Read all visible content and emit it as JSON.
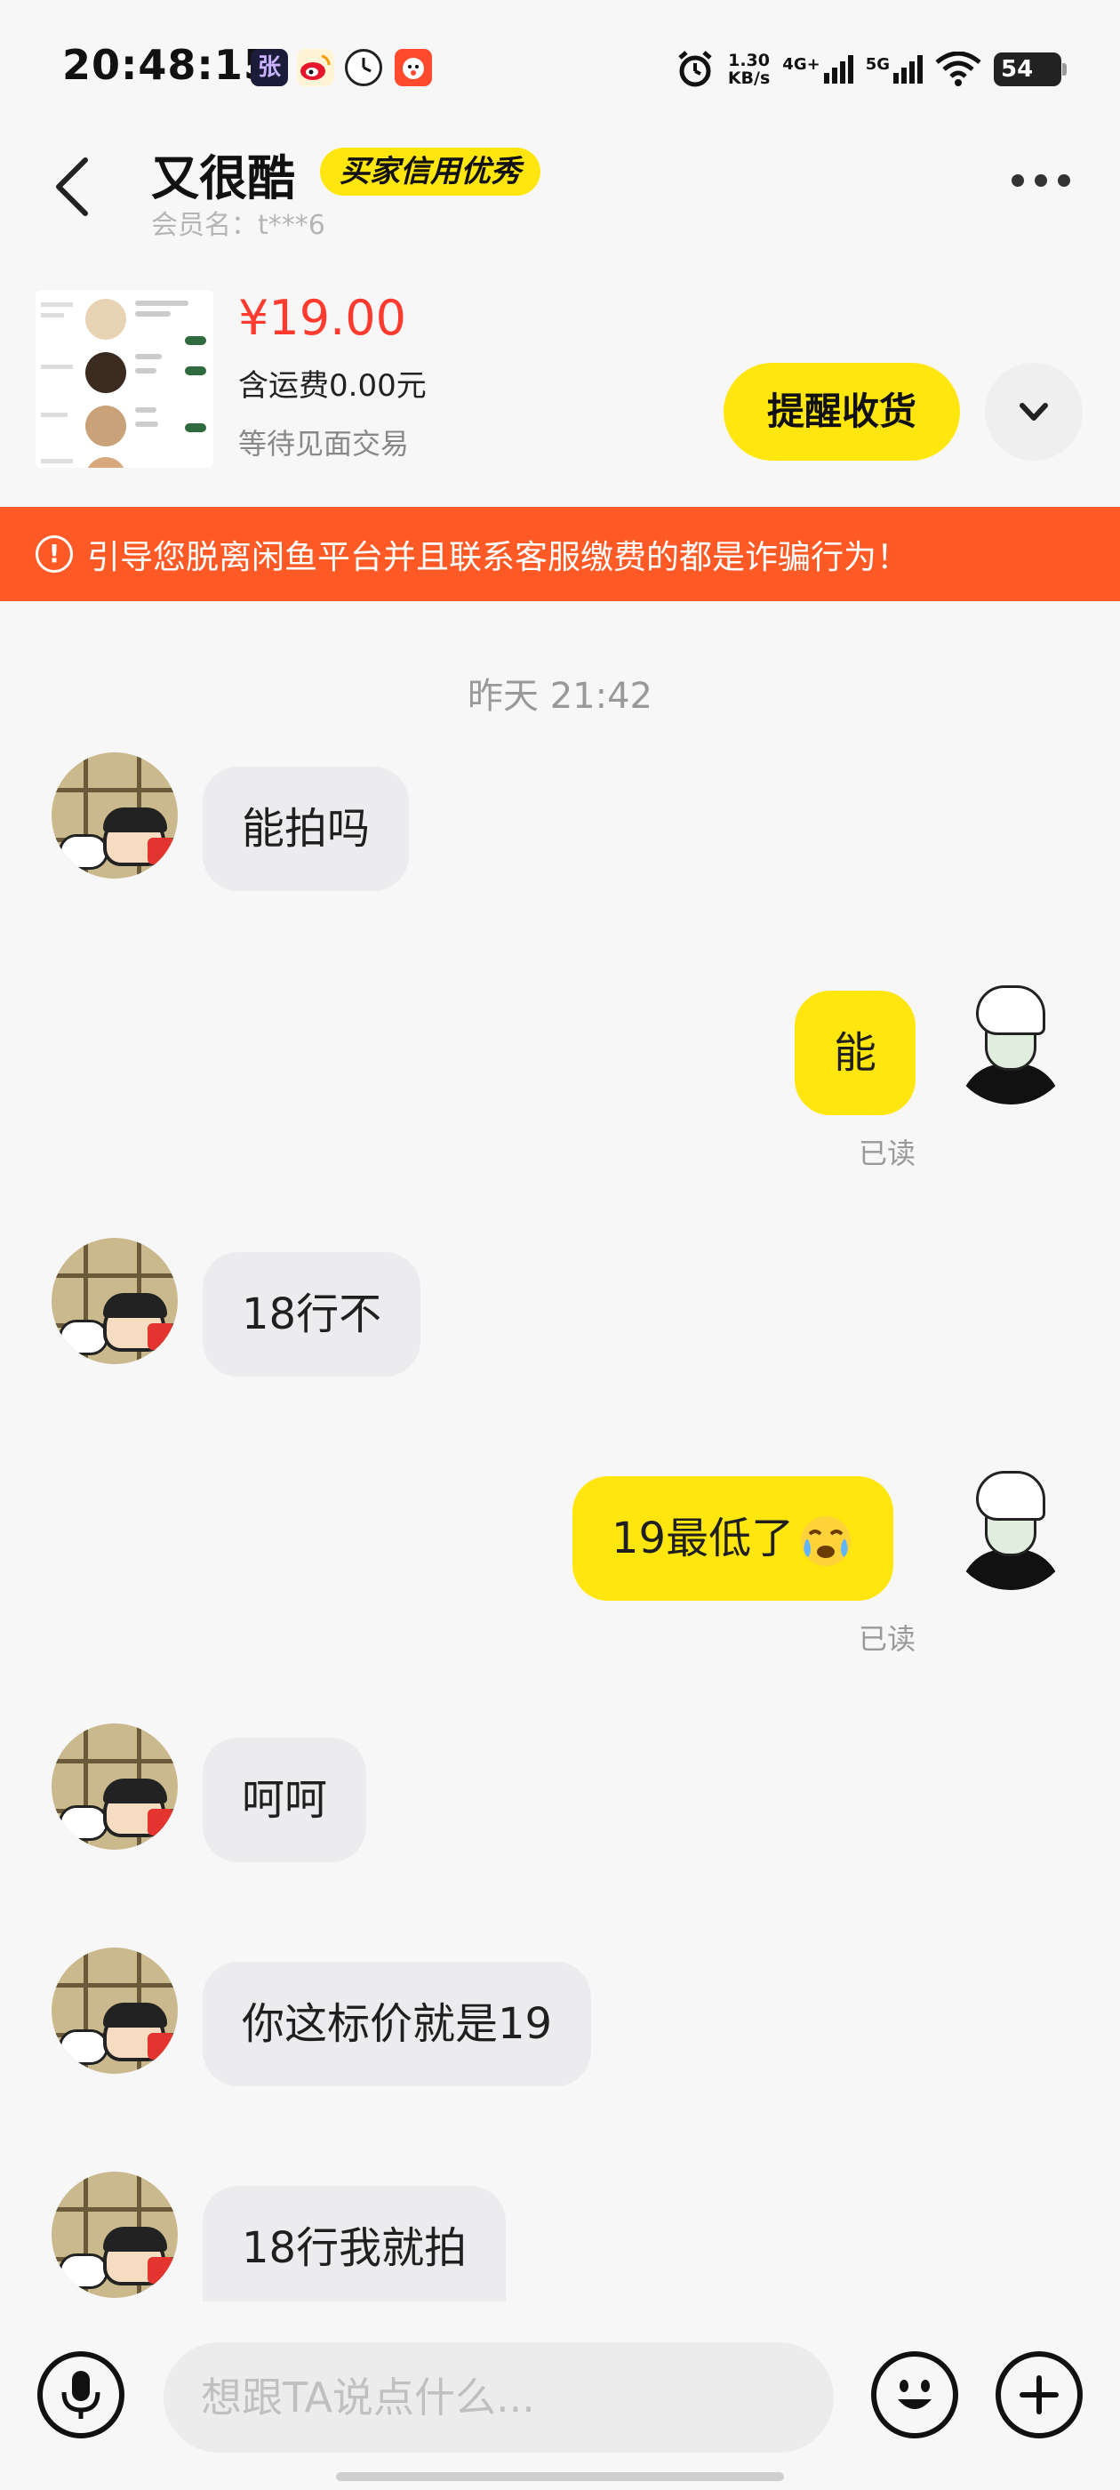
{
  "status_bar": {
    "time": "20:48:15",
    "speed_value": "1.30",
    "speed_unit": "KB/s",
    "net1": "4G+",
    "net2": "5G",
    "battery": "54",
    "icons": [
      "zhang-app-icon",
      "weibo-icon",
      "clock-app-icon",
      "pinduoduo-icon",
      "alarm-icon",
      "signal-icon",
      "wifi-icon",
      "battery-icon"
    ]
  },
  "header": {
    "contact_name": "又很酷",
    "credit_badge": "买家信用优秀",
    "member_label": "会员名：t***6"
  },
  "product": {
    "price": "¥19.00",
    "shipping": "含运费0.00元",
    "status": "等待见面交易",
    "remind_button": "提醒收货"
  },
  "warning": {
    "icon": "!",
    "text": "引导您脱离闲鱼平台并且联系客服缴费的都是诈骗行为！"
  },
  "chat": {
    "time_divider": "昨天 21:42",
    "messages": [
      {
        "from": "buyer",
        "text": "能拍吗"
      },
      {
        "from": "me",
        "text": "能",
        "read": "已读"
      },
      {
        "from": "buyer",
        "text": "18行不"
      },
      {
        "from": "me",
        "text": "19最低了",
        "emoji": "crying-face-emoji",
        "read": "已读"
      },
      {
        "from": "buyer",
        "text": "呵呵"
      },
      {
        "from": "buyer",
        "text": "你这标价就是19"
      },
      {
        "from": "buyer",
        "text": "18行我就拍"
      }
    ]
  },
  "input_bar": {
    "placeholder": "想跟TA说点什么..."
  },
  "colors": {
    "accent_yellow": "#ffe60f",
    "price_red": "#ff3b30",
    "warning_orange": "#ff5a26",
    "bubble_gray": "#ececef"
  }
}
